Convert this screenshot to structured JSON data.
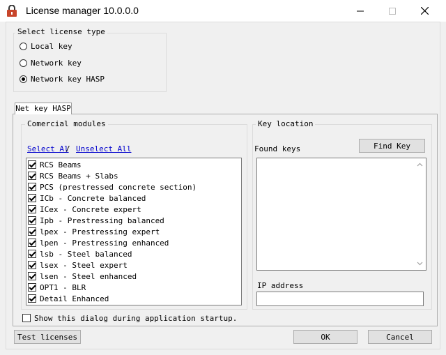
{
  "window": {
    "title": "License manager 10.0.0.0",
    "minimize_icon": "minimize-icon",
    "maximize_icon": "maximize-icon",
    "close_icon": "close-icon"
  },
  "license_type": {
    "label": "Select license type",
    "options": [
      {
        "label": "Local key",
        "selected": false
      },
      {
        "label": "Network key",
        "selected": false
      },
      {
        "label": "Network key HASP",
        "selected": true
      }
    ]
  },
  "tab": {
    "label": "Net key HASP"
  },
  "modules": {
    "label": "Comercial modules",
    "select_all": "Select Al",
    "separator": "/",
    "unselect_all": "Unselect All",
    "items": [
      {
        "label": "RCS Beams",
        "checked": true
      },
      {
        "label": "RCS Beams + Slabs",
        "checked": true
      },
      {
        "label": "PCS (prestressed concrete section)",
        "checked": true
      },
      {
        "label": "ICb - Concrete balanced",
        "checked": true
      },
      {
        "label": "ICex - Concrete expert",
        "checked": true
      },
      {
        "label": "Ipb - Prestressing balanced",
        "checked": true
      },
      {
        "label": "lpex - Prestressing expert",
        "checked": true
      },
      {
        "label": "lpen - Prestressing enhanced",
        "checked": true
      },
      {
        "label": "lsb - Steel balanced",
        "checked": true
      },
      {
        "label": "lsex - Steel expert",
        "checked": true
      },
      {
        "label": "lsen - Steel enhanced",
        "checked": true
      },
      {
        "label": "OPT1 - BLR",
        "checked": true
      },
      {
        "label": "Detail Enhanced",
        "checked": true
      }
    ]
  },
  "key_location": {
    "label": "Key location",
    "found_keys_label": "Found keys",
    "find_key_button": "Find Key",
    "ip_label": "IP address",
    "ip_value": ""
  },
  "startup": {
    "label": "Show this dialog during application startup.",
    "checked": false
  },
  "buttons": {
    "test": "Test licenses",
    "ok": "OK",
    "cancel": "Cancel"
  }
}
